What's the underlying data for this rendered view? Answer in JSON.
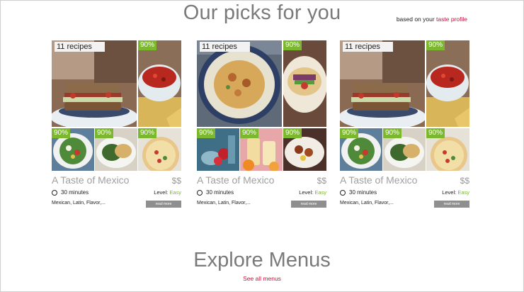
{
  "header": {
    "title": "Our picks for you",
    "taste_prefix": "based on your ",
    "taste_link": "taste profile"
  },
  "cards": [
    {
      "recipes_count": "11 recipes",
      "badges": [
        "90%",
        "90%",
        "90%",
        "90%"
      ],
      "title": "A Taste of Mexico",
      "price": "$$",
      "time": "30 minutes",
      "level_label": "Level: ",
      "level_value": "Easy",
      "tags": "Mexican, Latin, Flavor,...",
      "read_more": "read more"
    },
    {
      "recipes_count": "11 recipes",
      "badges": [
        "90%",
        "90%",
        "90%",
        "90%"
      ],
      "title": "A Taste of Mexico",
      "price": "$$",
      "time": "30 minutes",
      "level_label": "Level: ",
      "level_value": "Easy",
      "tags": "Mexican, Latin, Flavor,...",
      "read_more": "read more"
    },
    {
      "recipes_count": "11 recipes",
      "badges": [
        "90%",
        "90%",
        "90%",
        "90%"
      ],
      "title": "A Taste of Mexico",
      "price": "$$",
      "time": "30 minutes",
      "level_label": "Level: ",
      "level_value": "Easy",
      "tags": "Mexican, Latin, Flavor,...",
      "read_more": "read more"
    }
  ],
  "explore": {
    "title": "Explore Menus",
    "see_all": "See all menus"
  },
  "colors": {
    "accent_green": "#7bb82e",
    "link_red": "#c0143c",
    "title_gray": "#7a7a7a"
  }
}
